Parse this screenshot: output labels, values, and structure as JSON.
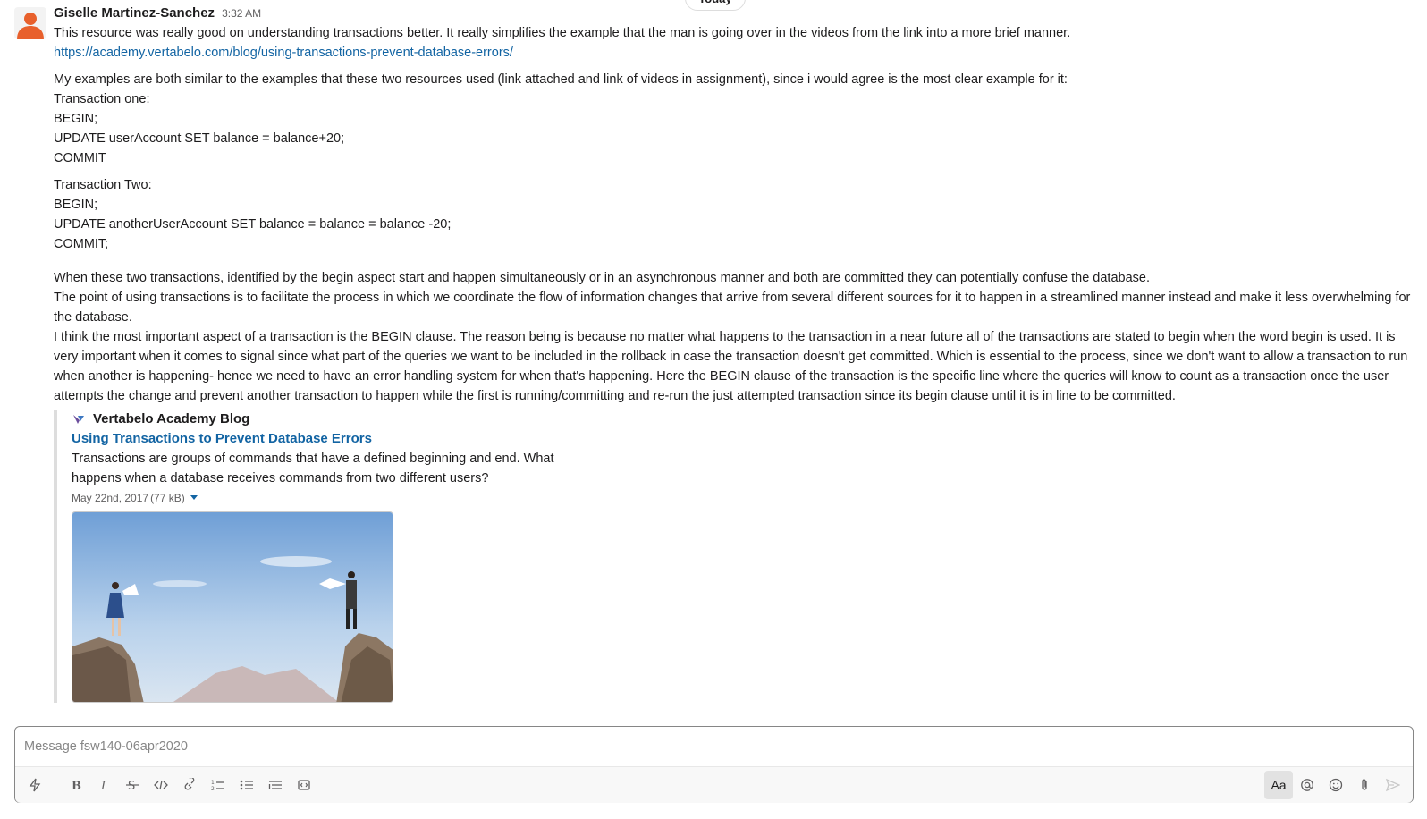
{
  "day_divider": "Today",
  "message": {
    "author": "Giselle Martinez-Sanchez",
    "timestamp": "3:32 AM",
    "intro": "This resource was really good on understanding transactions better. It really simplifies the example that the man is going over in the videos from the link into a more brief manner.",
    "link": "https://academy.vertabelo.com/blog/using-transactions-prevent-database-errors/",
    "examples_intro": "My examples are both similar to the examples that these two resources used (link attached and link of videos in assignment), since i would agree is the most clear example for it:",
    "transaction_one": [
      "Transaction one:",
      "BEGIN;",
      "UPDATE userAccount SET balance = balance+20;",
      "COMMIT"
    ],
    "transaction_two": [
      "Transaction Two:",
      "BEGIN;",
      "UPDATE anotherUserAccount SET balance = balance = balance -20;",
      "COMMIT;"
    ],
    "paragraphs": [
      "When these two transactions, identified by the begin aspect start and happen simultaneously or in an asynchronous manner and both are committed they can potentially confuse the database.",
      "The point of using transactions is to facilitate the process in which we coordinate the flow of information changes that arrive from several different sources for it to happen in a streamlined manner instead and make it less overwhelming for the database.",
      "I think the most important aspect of a transaction is the BEGIN clause. The reason being is because no matter what happens to the transaction in a near future all of the transactions are stated to begin when the word begin is used. It is very important when it comes to signal since what part of the queries we want to be included in the rollback in case the transaction doesn't get committed. Which is essential to the process, since we don't want to allow a transaction to run when another is happening- hence we need to have an error handling system for when that's happening. Here the BEGIN clause of the transaction is the specific line where the queries will know to count as a transaction once the user attempts the change and prevent another transaction to happen while the first is running/committing and re-run the just attempted transaction since its begin clause until it is in line to be committed."
    ]
  },
  "unfurl": {
    "site_name": "Vertabelo Academy Blog",
    "title": "Using Transactions to Prevent Database Errors",
    "description": "Transactions are groups of commands that have a defined beginning and end. What happens when a database receives commands from two different users?",
    "date": "May 22nd, 2017",
    "size": "(77 kB)"
  },
  "composer": {
    "placeholder": "Message fsw140-06apr2020",
    "format_label": "Aa"
  },
  "icons": {
    "shortcuts": "lightning-icon",
    "bold": "bold-icon",
    "italic": "italic-icon",
    "strike": "strikethrough-icon",
    "code": "code-icon",
    "link": "link-icon",
    "ordered": "ordered-list-icon",
    "bulleted": "bulleted-list-icon",
    "blockquote": "blockquote-icon",
    "codeblock": "code-block-icon",
    "mention": "at-mention-icon",
    "emoji": "emoji-icon",
    "attach": "paperclip-icon",
    "send": "send-icon"
  },
  "colors": {
    "link": "#1264a3",
    "avatar": "#e8602c",
    "composer_border": "#868686"
  }
}
